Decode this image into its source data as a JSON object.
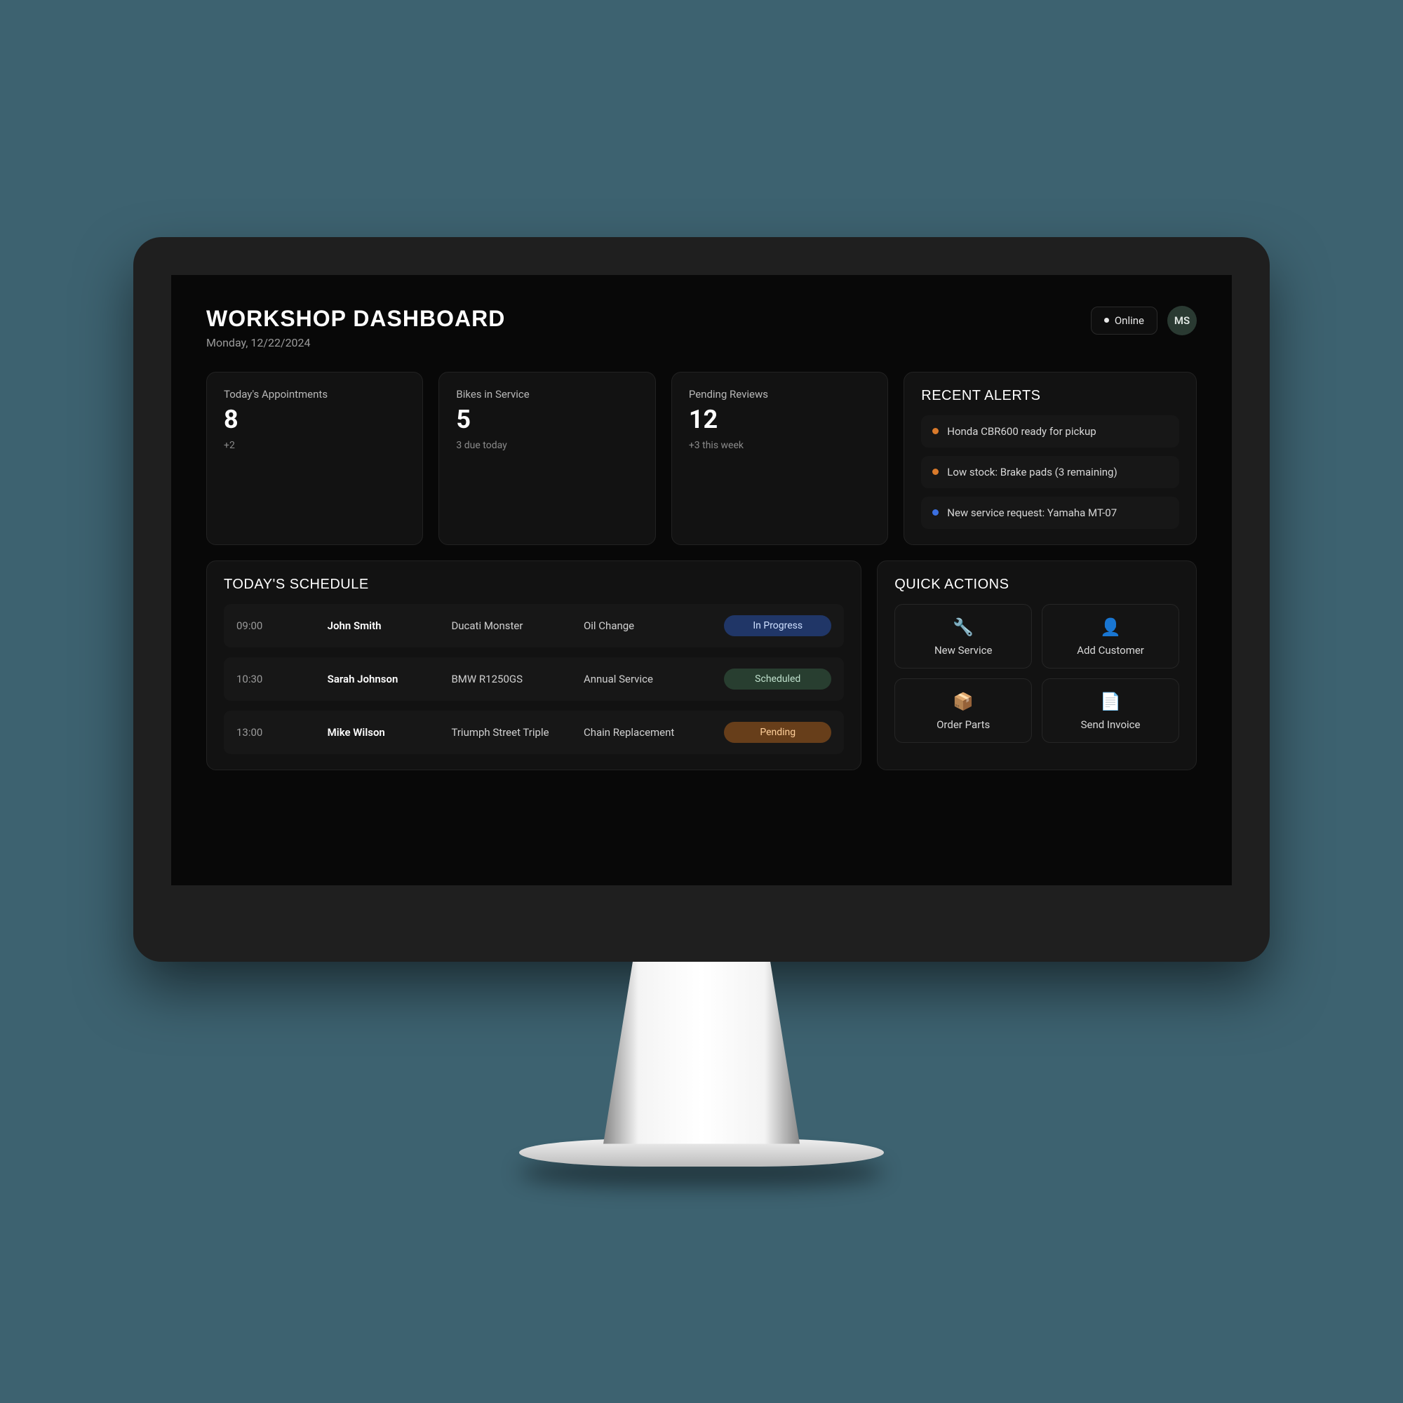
{
  "header": {
    "title": "WORKSHOP DASHBOARD",
    "date": "Monday, 12/22/2024",
    "status": "Online",
    "avatar": "MS"
  },
  "stats": [
    {
      "label": "Today's Appointments",
      "value": "8",
      "sub": "+2"
    },
    {
      "label": "Bikes in Service",
      "value": "5",
      "sub": "3 due today"
    },
    {
      "label": "Pending Reviews",
      "value": "12",
      "sub": "+3 this week"
    }
  ],
  "alerts": {
    "title": "RECENT ALERTS",
    "items": [
      {
        "text": "Honda CBR600 ready for pickup",
        "color": "orange"
      },
      {
        "text": "Low stock: Brake pads (3 remaining)",
        "color": "orange"
      },
      {
        "text": "New service request: Yamaha MT-07",
        "color": "blue"
      }
    ]
  },
  "schedule": {
    "title": "TODAY'S SCHEDULE",
    "rows": [
      {
        "time": "09:00",
        "name": "John Smith",
        "bike": "Ducati Monster",
        "service": "Oil Change",
        "status": "In Progress",
        "status_kind": "progress"
      },
      {
        "time": "10:30",
        "name": "Sarah Johnson",
        "bike": "BMW R1250GS",
        "service": "Annual Service",
        "status": "Scheduled",
        "status_kind": "scheduled"
      },
      {
        "time": "13:00",
        "name": "Mike Wilson",
        "bike": "Triumph Street Triple",
        "service": "Chain Replacement",
        "status": "Pending",
        "status_kind": "pending"
      }
    ]
  },
  "quick": {
    "title": "QUICK ACTIONS",
    "items": [
      {
        "label": "New Service",
        "icon": "🔧"
      },
      {
        "label": "Add Customer",
        "icon": "👤"
      },
      {
        "label": "Order Parts",
        "icon": "📦"
      },
      {
        "label": "Send Invoice",
        "icon": "📄"
      }
    ]
  }
}
